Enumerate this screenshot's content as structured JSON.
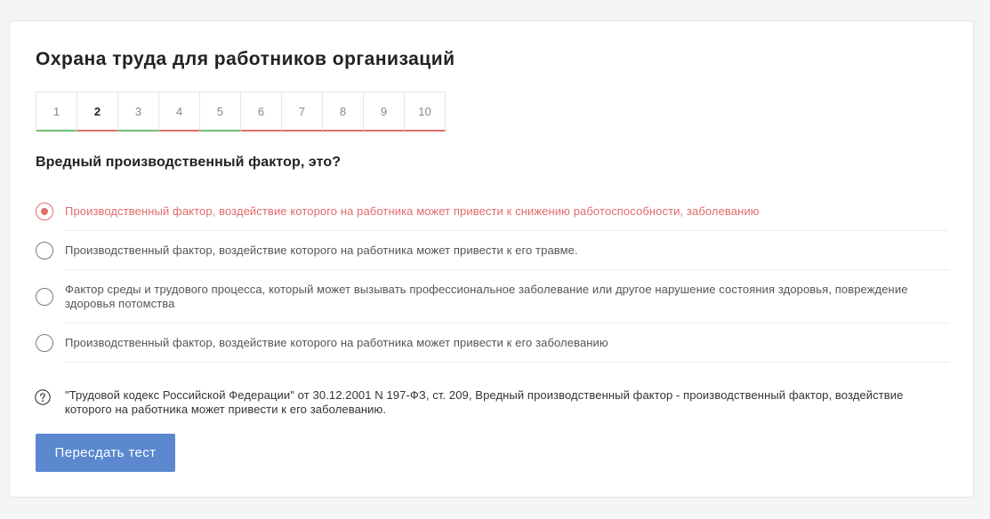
{
  "colors": {
    "page_background": "#f5f5f5",
    "incorrect": "#e26b6b",
    "correct": "#6fbe73",
    "accent": "#5b88cf"
  },
  "title": "Охрана труда для работников организаций",
  "tabs": [
    {
      "label": "1",
      "underline": "#6fbe73"
    },
    {
      "label": "2",
      "underline": "#e26b6b",
      "active": true
    },
    {
      "label": "3",
      "underline": "#6fbe73"
    },
    {
      "label": "4",
      "underline": "#e26b6b"
    },
    {
      "label": "5",
      "underline": "#6fbe73"
    },
    {
      "label": "6",
      "underline": "#e26b6b"
    },
    {
      "label": "7",
      "underline": "#e26b6b"
    },
    {
      "label": "8",
      "underline": "#e26b6b"
    },
    {
      "label": "9",
      "underline": "#e26b6b"
    },
    {
      "label": "10",
      "underline": "#e26b6b"
    }
  ],
  "question": "Вредный производственный фактор, это?",
  "options": [
    {
      "text": "Производственный фактор, воздействие которого на работника может привести к снижению работоспособности, заболеванию",
      "selected": true
    },
    {
      "text": "Производственный фактор, воздействие которого на работника может привести к его травме.",
      "selected": false
    },
    {
      "text": "Фактор среды и трудового процесса, который может вызывать профессиональное заболевание или другое нарушение состояния здоровья, повреждение здоровья потомства",
      "selected": false
    },
    {
      "text": "Производственный фактор, воздействие которого на работника может привести к его заболеванию",
      "selected": false
    }
  ],
  "explanation": {
    "icon": "question-circle-icon",
    "text": "\"Трудовой кодекс Российской Федерации\" от 30.12.2001 N 197-ФЗ, ст. 209, Вредный производственный фактор - производственный фактор, воздействие которого на работника может привести к его заболеванию."
  },
  "retake_button": {
    "label": "Пересдать тест"
  }
}
